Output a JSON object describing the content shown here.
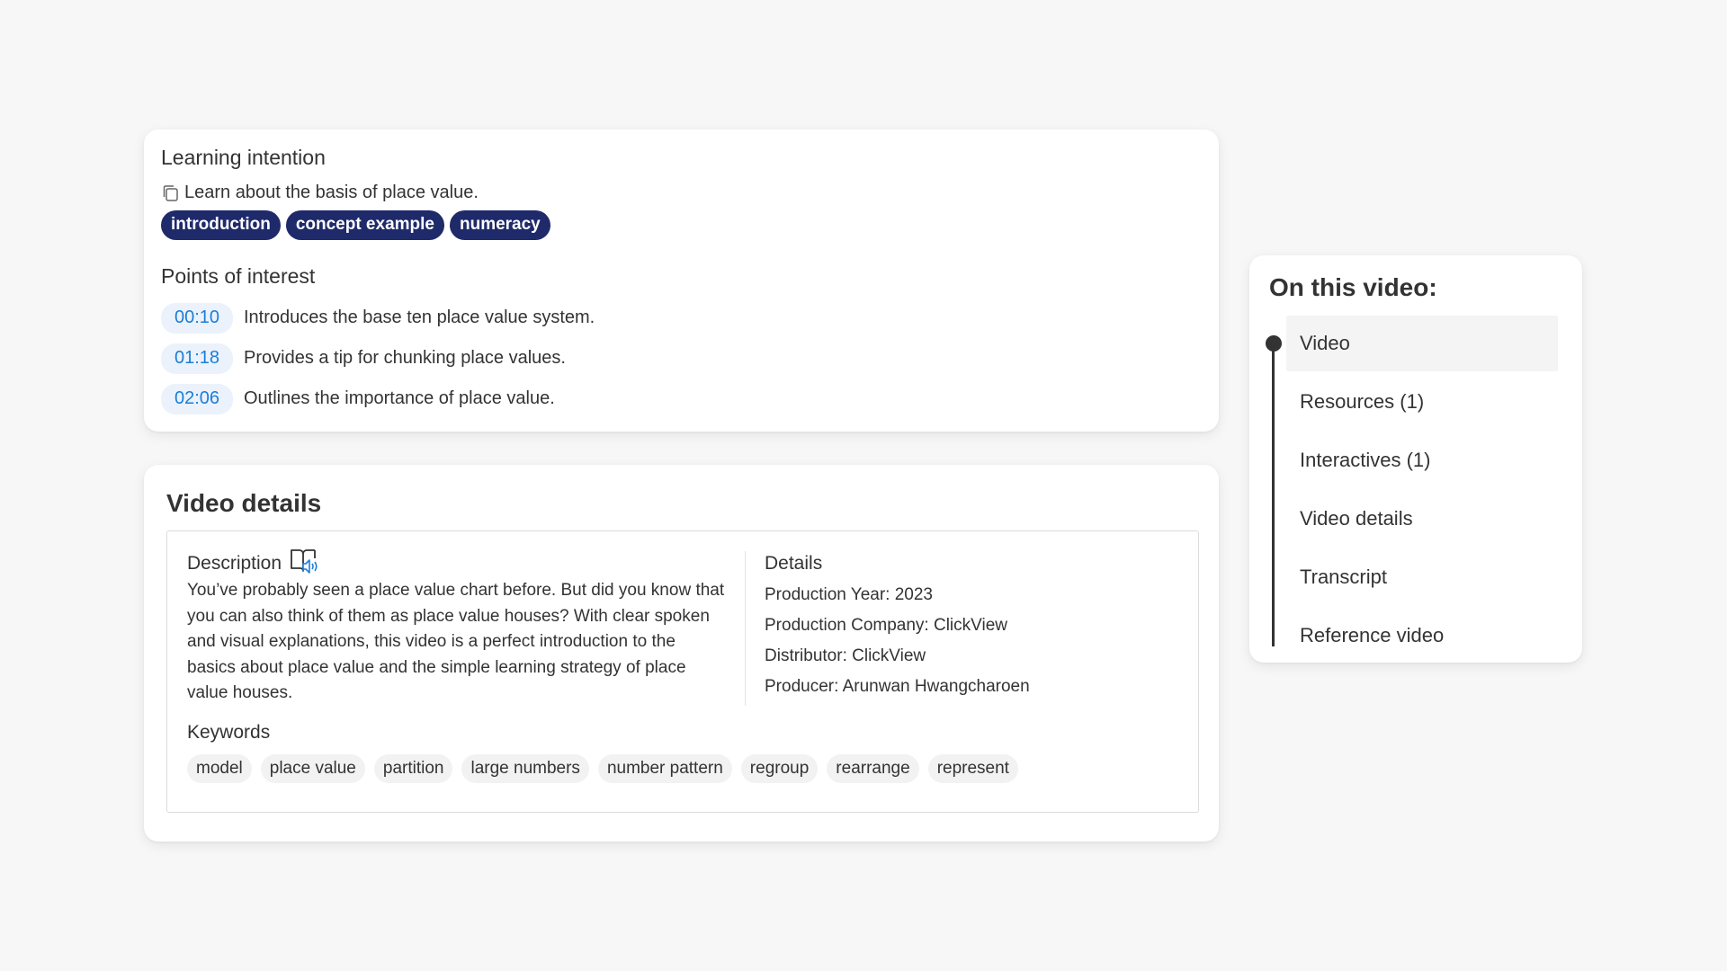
{
  "learning_intention": {
    "title": "Learning intention",
    "text": "Learn about the basis of place value.",
    "tags": [
      "introduction",
      "concept example",
      "numeracy"
    ]
  },
  "points_of_interest": {
    "title": "Points of interest",
    "items": [
      {
        "time": "00:10",
        "text": "Introduces the base ten place value system."
      },
      {
        "time": "01:18",
        "text": "Provides a tip for chunking place values."
      },
      {
        "time": "02:06",
        "text": "Outlines the importance of place value."
      }
    ]
  },
  "video_details": {
    "title": "Video details",
    "description_title": "Description",
    "description": "You’ve probably seen a place value chart before. But did you know that you can also think of them as place value houses? With clear spoken and visual explanations, this video is a perfect introduction to the basics about place value and the simple learning strategy of place value houses.",
    "details_title": "Details",
    "details": [
      "Production Year: 2023",
      "Production Company: ClickView",
      "Distributor: ClickView",
      "Producer: Arunwan Hwangcharoen"
    ],
    "keywords_title": "Keywords",
    "keywords": [
      "model",
      "place value",
      "partition",
      "large numbers",
      "number pattern",
      "regroup",
      "rearrange",
      "represent"
    ]
  },
  "on_this_video": {
    "title": "On this video:",
    "items": [
      "Video",
      "Resources (1)",
      "Interactives (1)",
      "Video details",
      "Transcript",
      "Reference video"
    ],
    "active_index": 0
  },
  "colors": {
    "tag_bg": "#1f2a6b",
    "time_chip_bg": "#ebf2fb",
    "time_chip_text": "#1a7ed8",
    "page_bg": "#f7f7f7"
  },
  "icons": {
    "copy": "copy-icon",
    "read_aloud": "read-aloud-icon"
  }
}
